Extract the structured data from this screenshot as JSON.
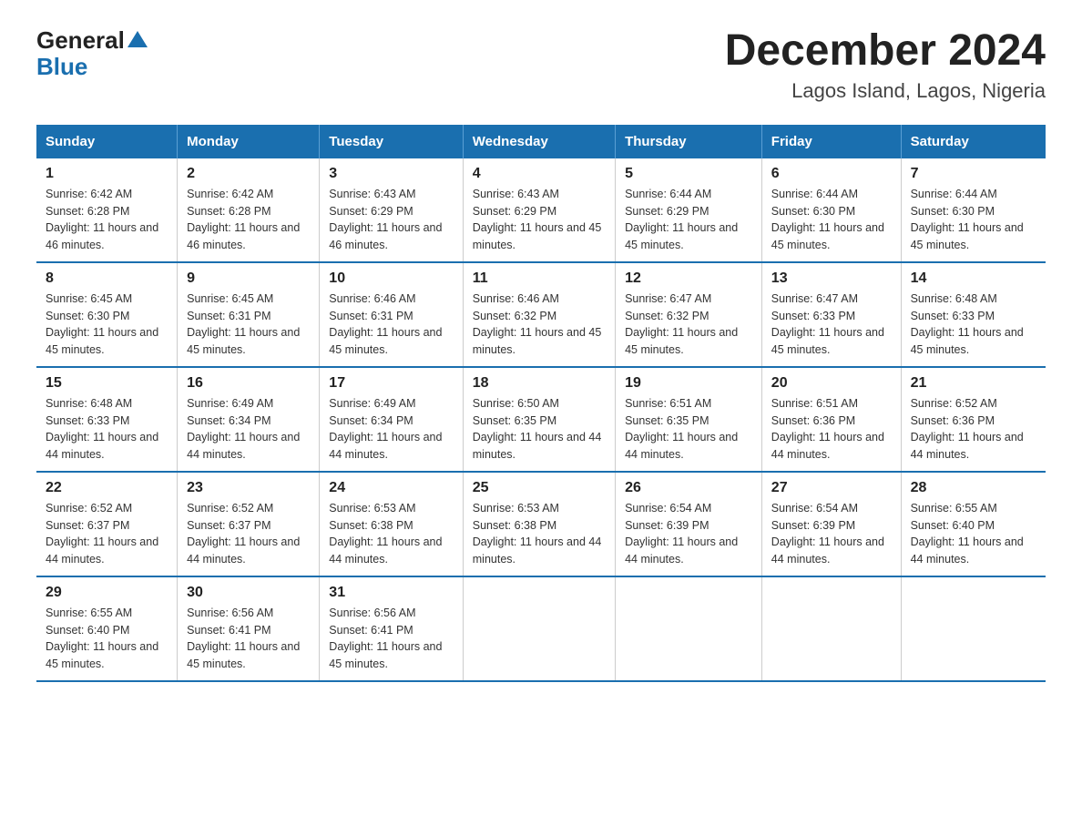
{
  "logo": {
    "general": "General",
    "arrow": "▶",
    "blue": "Blue"
  },
  "title": "December 2024",
  "subtitle": "Lagos Island, Lagos, Nigeria",
  "days_of_week": [
    "Sunday",
    "Monday",
    "Tuesday",
    "Wednesday",
    "Thursday",
    "Friday",
    "Saturday"
  ],
  "weeks": [
    [
      {
        "day": "1",
        "sunrise": "6:42 AM",
        "sunset": "6:28 PM",
        "daylight": "11 hours and 46 minutes."
      },
      {
        "day": "2",
        "sunrise": "6:42 AM",
        "sunset": "6:28 PM",
        "daylight": "11 hours and 46 minutes."
      },
      {
        "day": "3",
        "sunrise": "6:43 AM",
        "sunset": "6:29 PM",
        "daylight": "11 hours and 46 minutes."
      },
      {
        "day": "4",
        "sunrise": "6:43 AM",
        "sunset": "6:29 PM",
        "daylight": "11 hours and 45 minutes."
      },
      {
        "day": "5",
        "sunrise": "6:44 AM",
        "sunset": "6:29 PM",
        "daylight": "11 hours and 45 minutes."
      },
      {
        "day": "6",
        "sunrise": "6:44 AM",
        "sunset": "6:30 PM",
        "daylight": "11 hours and 45 minutes."
      },
      {
        "day": "7",
        "sunrise": "6:44 AM",
        "sunset": "6:30 PM",
        "daylight": "11 hours and 45 minutes."
      }
    ],
    [
      {
        "day": "8",
        "sunrise": "6:45 AM",
        "sunset": "6:30 PM",
        "daylight": "11 hours and 45 minutes."
      },
      {
        "day": "9",
        "sunrise": "6:45 AM",
        "sunset": "6:31 PM",
        "daylight": "11 hours and 45 minutes."
      },
      {
        "day": "10",
        "sunrise": "6:46 AM",
        "sunset": "6:31 PM",
        "daylight": "11 hours and 45 minutes."
      },
      {
        "day": "11",
        "sunrise": "6:46 AM",
        "sunset": "6:32 PM",
        "daylight": "11 hours and 45 minutes."
      },
      {
        "day": "12",
        "sunrise": "6:47 AM",
        "sunset": "6:32 PM",
        "daylight": "11 hours and 45 minutes."
      },
      {
        "day": "13",
        "sunrise": "6:47 AM",
        "sunset": "6:33 PM",
        "daylight": "11 hours and 45 minutes."
      },
      {
        "day": "14",
        "sunrise": "6:48 AM",
        "sunset": "6:33 PM",
        "daylight": "11 hours and 45 minutes."
      }
    ],
    [
      {
        "day": "15",
        "sunrise": "6:48 AM",
        "sunset": "6:33 PM",
        "daylight": "11 hours and 44 minutes."
      },
      {
        "day": "16",
        "sunrise": "6:49 AM",
        "sunset": "6:34 PM",
        "daylight": "11 hours and 44 minutes."
      },
      {
        "day": "17",
        "sunrise": "6:49 AM",
        "sunset": "6:34 PM",
        "daylight": "11 hours and 44 minutes."
      },
      {
        "day": "18",
        "sunrise": "6:50 AM",
        "sunset": "6:35 PM",
        "daylight": "11 hours and 44 minutes."
      },
      {
        "day": "19",
        "sunrise": "6:51 AM",
        "sunset": "6:35 PM",
        "daylight": "11 hours and 44 minutes."
      },
      {
        "day": "20",
        "sunrise": "6:51 AM",
        "sunset": "6:36 PM",
        "daylight": "11 hours and 44 minutes."
      },
      {
        "day": "21",
        "sunrise": "6:52 AM",
        "sunset": "6:36 PM",
        "daylight": "11 hours and 44 minutes."
      }
    ],
    [
      {
        "day": "22",
        "sunrise": "6:52 AM",
        "sunset": "6:37 PM",
        "daylight": "11 hours and 44 minutes."
      },
      {
        "day": "23",
        "sunrise": "6:52 AM",
        "sunset": "6:37 PM",
        "daylight": "11 hours and 44 minutes."
      },
      {
        "day": "24",
        "sunrise": "6:53 AM",
        "sunset": "6:38 PM",
        "daylight": "11 hours and 44 minutes."
      },
      {
        "day": "25",
        "sunrise": "6:53 AM",
        "sunset": "6:38 PM",
        "daylight": "11 hours and 44 minutes."
      },
      {
        "day": "26",
        "sunrise": "6:54 AM",
        "sunset": "6:39 PM",
        "daylight": "11 hours and 44 minutes."
      },
      {
        "day": "27",
        "sunrise": "6:54 AM",
        "sunset": "6:39 PM",
        "daylight": "11 hours and 44 minutes."
      },
      {
        "day": "28",
        "sunrise": "6:55 AM",
        "sunset": "6:40 PM",
        "daylight": "11 hours and 44 minutes."
      }
    ],
    [
      {
        "day": "29",
        "sunrise": "6:55 AM",
        "sunset": "6:40 PM",
        "daylight": "11 hours and 45 minutes."
      },
      {
        "day": "30",
        "sunrise": "6:56 AM",
        "sunset": "6:41 PM",
        "daylight": "11 hours and 45 minutes."
      },
      {
        "day": "31",
        "sunrise": "6:56 AM",
        "sunset": "6:41 PM",
        "daylight": "11 hours and 45 minutes."
      },
      null,
      null,
      null,
      null
    ]
  ],
  "labels": {
    "sunrise_prefix": "Sunrise: ",
    "sunset_prefix": "Sunset: ",
    "daylight_prefix": "Daylight: "
  },
  "colors": {
    "header_bg": "#1a6faf",
    "header_text": "#ffffff",
    "border_blue": "#1a6faf"
  }
}
